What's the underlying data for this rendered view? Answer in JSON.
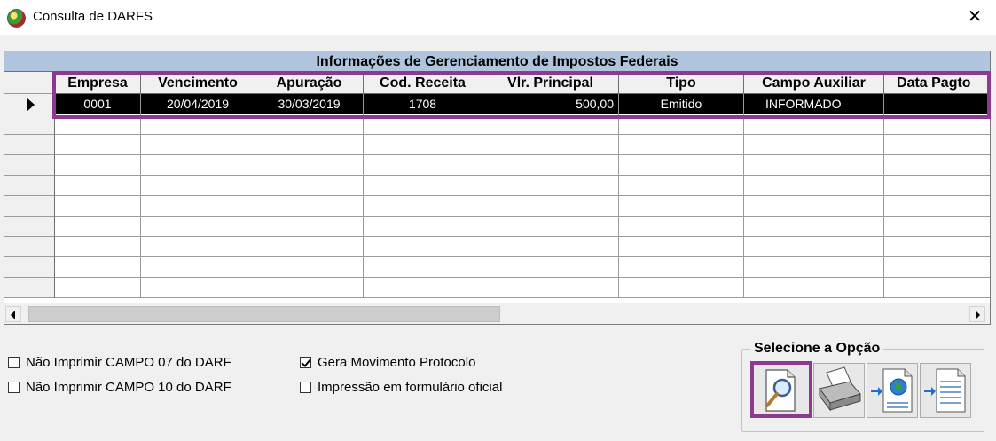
{
  "window": {
    "title": "Consulta de DARFS",
    "close_glyph": "✕",
    "icon": "app-globe-icon"
  },
  "grid": {
    "banner": "Informações de Gerenciamento de Impostos Federais",
    "columns": [
      "Empresa",
      "Vencimento",
      "Apuração",
      "Cod. Receita",
      "Vlr. Principal",
      "Tipo",
      "Campo Auxiliar",
      "Data Pagto"
    ],
    "rows": [
      [
        "0001",
        "20/04/2019",
        "30/03/2019",
        "1708",
        "500,00",
        "Emitido",
        "INFORMADO",
        ""
      ]
    ],
    "selected_row": 0
  },
  "options": {
    "nao_imprimir_07": {
      "label": "Não Imprimir CAMPO 07 do DARF",
      "checked": false
    },
    "nao_imprimir_10": {
      "label": "Não Imprimir CAMPO 10 do DARF",
      "checked": false
    },
    "gera_movimento": {
      "label": "Gera Movimento Protocolo",
      "checked": true
    },
    "impressao_oficial": {
      "label": "Impressão em formulário oficial",
      "checked": false
    }
  },
  "select_group": {
    "title": "Selecione a Opção",
    "buttons": [
      {
        "icon": "magnifier-preview-icon",
        "active": true
      },
      {
        "icon": "printer-icon",
        "active": false
      },
      {
        "icon": "export-web-icon",
        "active": false
      },
      {
        "icon": "export-document-icon",
        "active": false
      }
    ]
  },
  "colors": {
    "banner": "#b0c4de",
    "highlight": "#8b3a8f",
    "selected_row": "#000000"
  }
}
